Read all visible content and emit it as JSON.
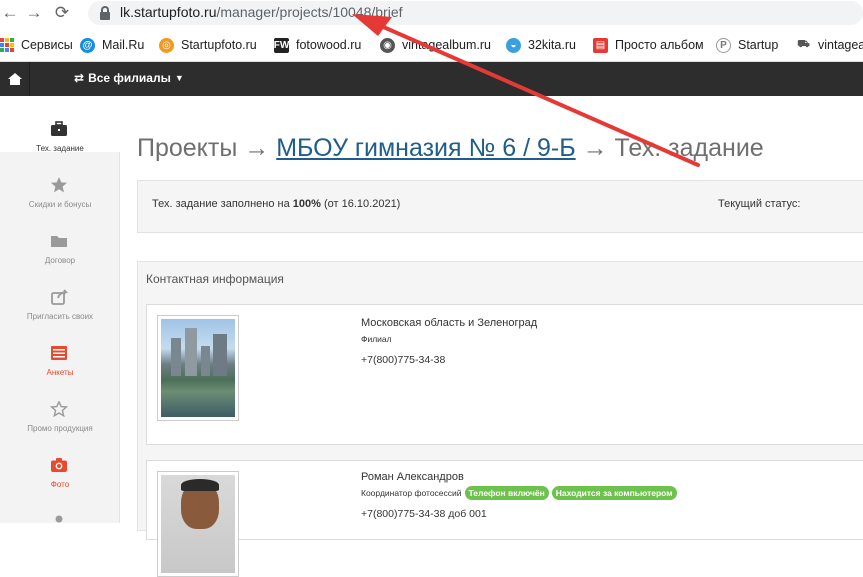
{
  "browser": {
    "url_host": "lk.startupfoto.ru",
    "url_path": "/manager/projects/10048/brief",
    "bookmarks": [
      {
        "label": "Сервисы",
        "icon": "apps-grid-icon"
      },
      {
        "label": "Mail.Ru",
        "icon": "mailru-icon"
      },
      {
        "label": "Startupfoto.ru",
        "icon": "startupfoto-icon"
      },
      {
        "label": "fotowood.ru",
        "icon": "fotowood-icon",
        "icon_text": "FW"
      },
      {
        "label": "vintagealbum.ru",
        "icon": "vintagealbum-icon"
      },
      {
        "label": "32kita.ru",
        "icon": "whale-icon"
      },
      {
        "label": "Просто альбом",
        "icon": "pdf-icon"
      },
      {
        "label": "Startup",
        "icon": "startup-icon"
      },
      {
        "label": "vintagea",
        "icon": "vintage-car-icon"
      }
    ]
  },
  "topbar": {
    "branches_label": "Все филиалы"
  },
  "sidebar": {
    "items": [
      {
        "label": "Тех. задание",
        "icon": "briefcase-icon",
        "state": "active"
      },
      {
        "label": "Скидки и бонусы",
        "icon": "star-icon",
        "state": "normal"
      },
      {
        "label": "Договор",
        "icon": "folder-icon",
        "state": "normal"
      },
      {
        "label": "Пригласить своих",
        "icon": "share-icon",
        "state": "normal"
      },
      {
        "label": "Анкеты",
        "icon": "list-icon",
        "state": "red"
      },
      {
        "label": "Промо продукция",
        "icon": "star-outline-icon",
        "state": "normal"
      },
      {
        "label": "Фото",
        "icon": "camera-icon",
        "state": "red"
      }
    ]
  },
  "main": {
    "title_prefix": "Проекты →",
    "title_link": "МБОУ гимназия № 6 / 9-Б",
    "title_suffix": "→ Тех. задание",
    "brief": {
      "text_before": "Тех. задание заполнено на",
      "percent": "100%",
      "text_after": "(от 16.10.2021)",
      "status_label": "Текущий статус:"
    },
    "contacts": {
      "heading": "Контактная информация",
      "cards": [
        {
          "name": "Московская область и Зеленоград",
          "role": "Филиал",
          "badges": [],
          "phone": "+7(800)775-34-38"
        },
        {
          "name": "Роман Александров",
          "role": "Координатор фотосессий",
          "badges": [
            "Телефон включён",
            "Находится за компьютером"
          ],
          "phone": "+7(800)775-34-38 доб 001"
        }
      ]
    }
  },
  "colors": {
    "topbar": "#2d2d2d",
    "accent_red": "#e8492f",
    "link": "#1f5d8a",
    "badge_green": "#6cc24a",
    "annotation_arrow": "#e53935"
  }
}
